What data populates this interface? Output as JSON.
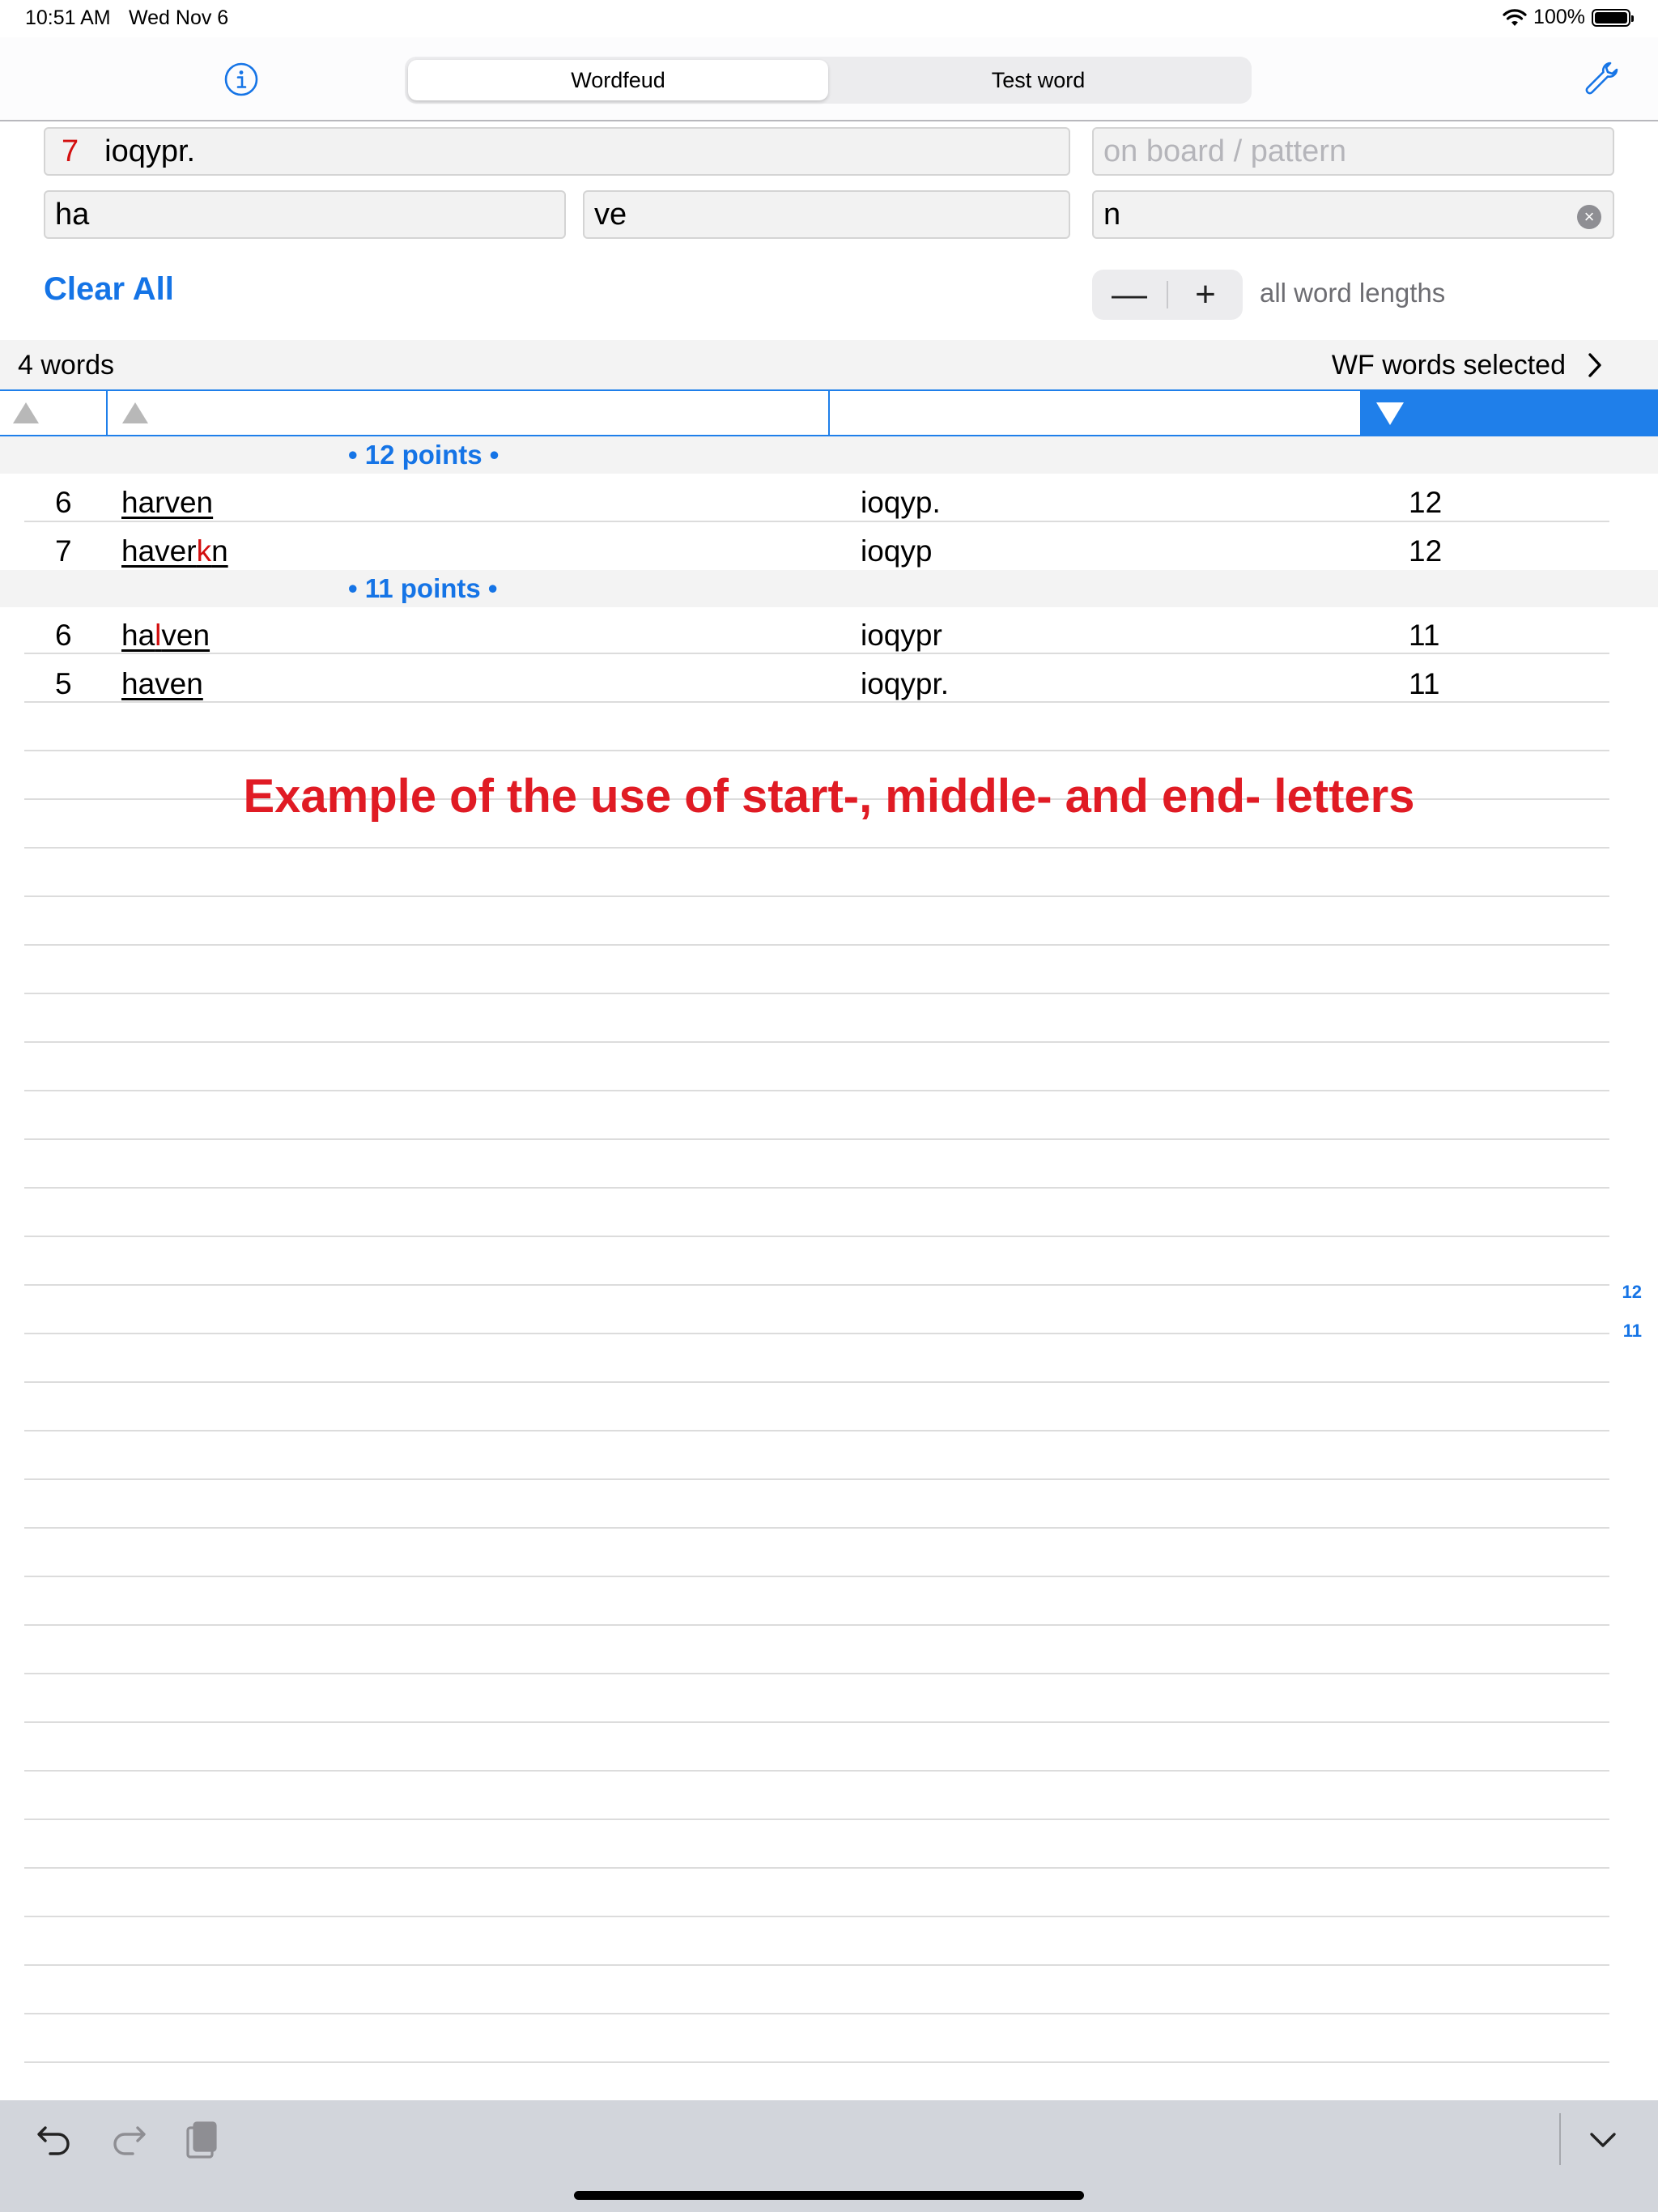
{
  "status_bar": {
    "time": "10:51 AM",
    "date": "Wed Nov 6",
    "battery": "100%"
  },
  "nav": {
    "segments": [
      "Wordfeud",
      "Test word"
    ],
    "selected_segment": "Wordfeud"
  },
  "inputs": {
    "rack_count": "7",
    "rack_value": "ioqypr.",
    "board_placeholder": "on board / pattern",
    "start_letters": "ha",
    "middle_letters": "ve",
    "end_letters": "n"
  },
  "controls": {
    "clear_all": "Clear All",
    "minus": "—",
    "plus": "+",
    "length_label": "all word lengths"
  },
  "summary": {
    "count": "4 words",
    "selected": "WF words selected"
  },
  "groups": [
    {
      "label": "• 12 points •",
      "rows": [
        {
          "len": "6",
          "word_parts": [
            [
              "har",
              false
            ],
            [
              "ven",
              false
            ]
          ],
          "rack": "ioqyp.",
          "points": "12"
        },
        {
          "len": "7",
          "word_parts": [
            [
              "haver",
              false
            ],
            [
              "k",
              true
            ],
            [
              "n",
              false
            ]
          ],
          "rack": "ioqyp",
          "points": "12"
        }
      ]
    },
    {
      "label": "• 11 points •",
      "rows": [
        {
          "len": "6",
          "word_parts": [
            [
              "ha",
              false
            ],
            [
              "l",
              true
            ],
            [
              "ven",
              false
            ]
          ],
          "rack": "ioqypr",
          "points": "11"
        },
        {
          "len": "5",
          "word_parts": [
            [
              "haven",
              false
            ]
          ],
          "rack": "ioqypr.",
          "points": "11"
        }
      ]
    }
  ],
  "caption": "Example of the use of start-, middle- and end- letters",
  "section_index": [
    "12",
    "11"
  ],
  "colors": {
    "accent": "#1f7fea",
    "highlight": "#d30f0f",
    "caption": "#e01b24"
  }
}
